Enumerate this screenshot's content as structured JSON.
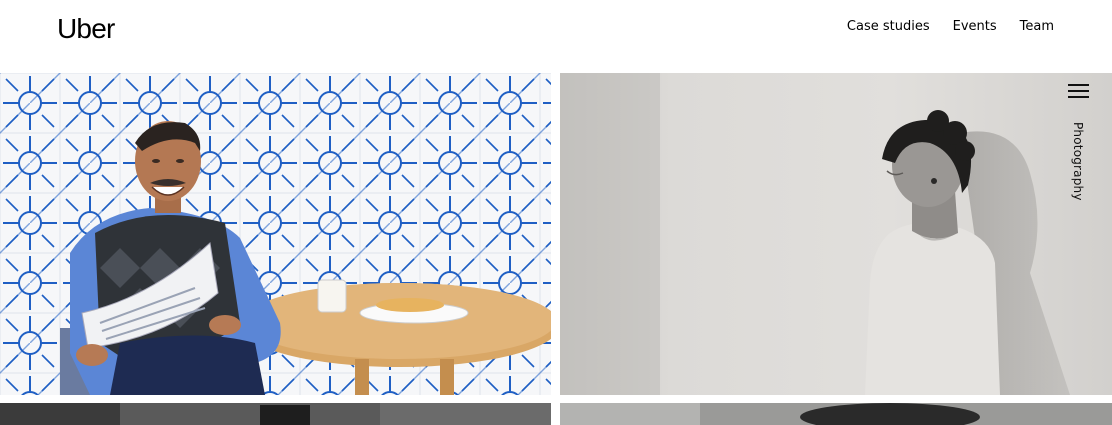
{
  "brand": {
    "logo": "Uber"
  },
  "nav": {
    "items": [
      "Case studies",
      "Events",
      "Team"
    ]
  },
  "gallery": {
    "category_label": "Photography",
    "tiles": [
      {
        "subject": "smiling man reading newspaper at cafe table in front of blue patterned tiles"
      },
      {
        "subject": "woman with curly hair leaning against wall, black and white"
      },
      {
        "subject": "partial photo, dark building"
      },
      {
        "subject": "partial photo, monochrome"
      }
    ]
  },
  "colors": {
    "tile_blue": "#1f5fc4",
    "shirt_blue": "#5b86d6",
    "wall_gray": "#d8d6d3"
  }
}
